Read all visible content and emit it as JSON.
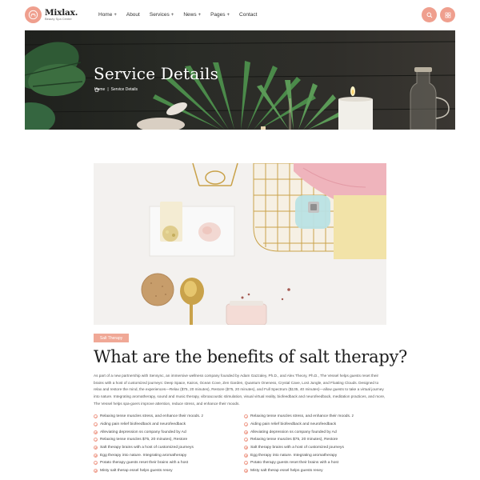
{
  "brand": {
    "name": "Mixlax.",
    "tagline": "Beauty Spa Center",
    "accent": "#ef9f8e"
  },
  "nav": {
    "items": [
      {
        "label": "Home",
        "has_dropdown": true
      },
      {
        "label": "About",
        "has_dropdown": false
      },
      {
        "label": "Services",
        "has_dropdown": true
      },
      {
        "label": "News",
        "has_dropdown": true
      },
      {
        "label": "Pages",
        "has_dropdown": true
      },
      {
        "label": "Contact",
        "has_dropdown": false
      }
    ],
    "caret": "+",
    "search_icon": "search-icon",
    "menu_icon": "grid-menu-icon"
  },
  "hero": {
    "title": "Service Details",
    "breadcrumb": {
      "home": "Home",
      "separator": "|",
      "current": "Service Details"
    }
  },
  "article": {
    "tag": "Salt Therapy",
    "heading": "What are the benefits of salt therapy?",
    "paragraph": "As part of a new partnership with Sensync, an immersive wellness company founded by Adam Gazzaley, Ph.D., and Alex Theory, Ph.D., The Vessel helps guests reset their brains with a host of customized journeys: Deep Space, Kairos, Ocean Cove, Zen Garden, Quantum Oneness, Crystal Cave, Lost Jungle, and Floating Clouds. Designed to relax and restore the mind, the experiences—Relax ($75, 20 minutes), Restore ($75, 20 minutes), and Full Spectrum ($135, 40 minutes)—allow guests to take a virtual journey into nature. Integrating aromatherapy, sound and music therapy, vibroacoustic stimulation, visual virtual reality, biofeedback and neurofeedback, meditation practices, and more, The Vessel helps spa-goers improve attention, reduce stress, and enhance their moods.",
    "list_left": [
      "Relaxing tense muscles stress, and enhance their moods. z",
      "Aiding pain relief biofeedback and neurofeedback",
      "Alleviating depression ss company founded by Ad",
      "Relaxing tense muscles $75, 20 minutes), Restore",
      "Salt therapy brains with a host of customized journeys",
      "Egg therapy into nature. Integrating aromatherapy",
      "Potato therapy guests reset their brains with a host",
      "Misty salt therap essel helps guests resey"
    ],
    "list_right": [
      "Relaxing tense muscles stress, and enhance their moods. z",
      "Aiding pain relief biofeedback and neurofeedback",
      "Alleviating depression ss company founded by Ad",
      "Relaxing tense muscles $75, 20 minutes), Restore",
      "Salt therapy brains with a host of customized journeys",
      "Egg therapy into nature. Integrating aromatherapy",
      "Potato therapy guests reset their brains with a host",
      "Misty salt therap essel helps guests resey"
    ]
  }
}
